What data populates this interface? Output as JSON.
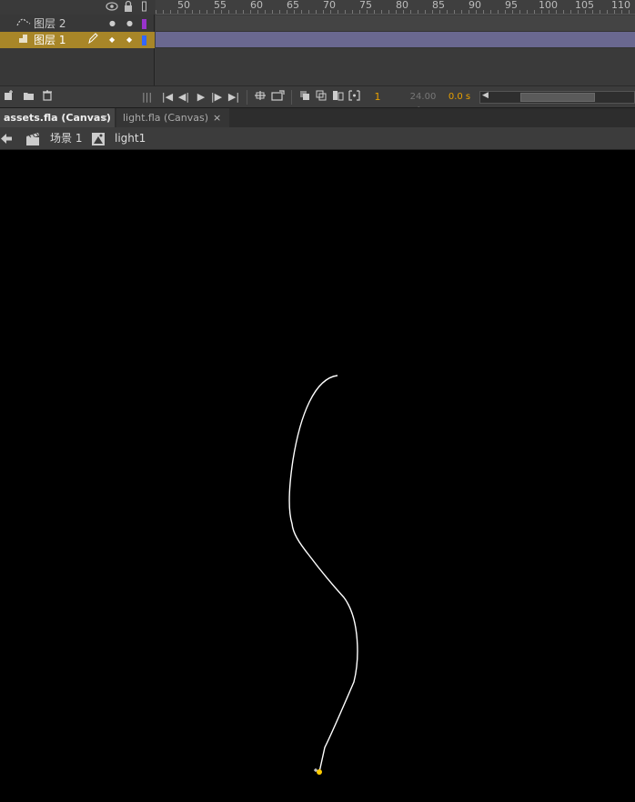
{
  "timeline": {
    "ruler": [
      "50",
      "55",
      "60",
      "65",
      "70",
      "75",
      "80",
      "85",
      "90",
      "95",
      "100",
      "105",
      "110"
    ],
    "header_icons": [
      "eye-icon",
      "lock-icon",
      "outline-icon"
    ],
    "layers": [
      {
        "name": "图层 2",
        "icon": "motion-guide-icon",
        "color": "#9933cc",
        "selected": false
      },
      {
        "name": "图层 1",
        "icon": "layer-icon",
        "color": "#3366ff",
        "selected": true
      }
    ],
    "frame_rate": "24.00 fps",
    "current_frame": "1",
    "elapsed": "0.0 s"
  },
  "tabs": {
    "assets": "assets.fla (Canvas)",
    "light": "light.fla (Canvas)",
    "close": "×"
  },
  "edit_bar": {
    "scene": "场景 1",
    "symbol": "light1"
  },
  "colors": {
    "selected_layer": "#a88628",
    "frame_span": "#6a6890",
    "accent": "#e8a000",
    "path": "#ffffff",
    "anchor": "#ffcc00"
  }
}
